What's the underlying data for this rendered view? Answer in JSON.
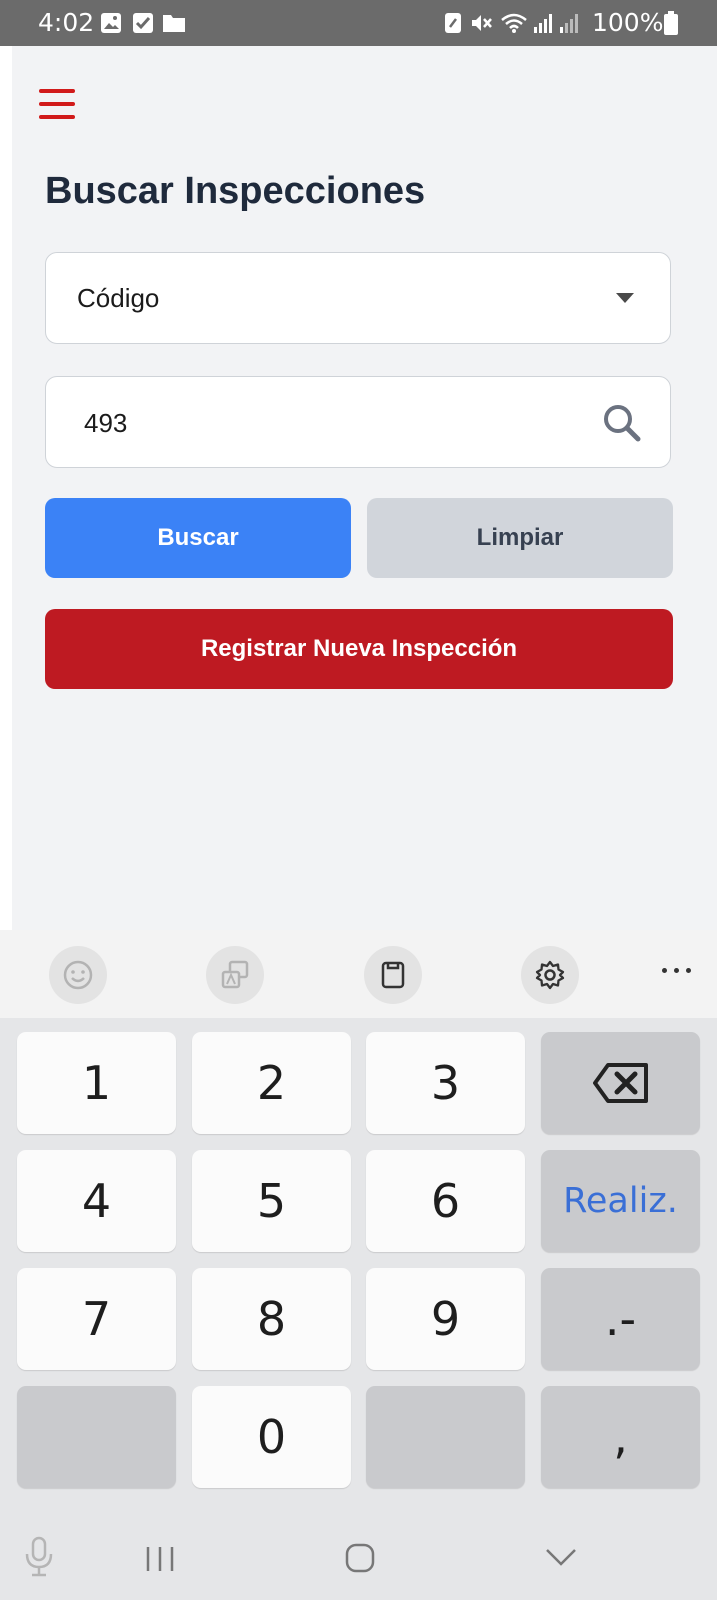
{
  "status_bar": {
    "time": "4:02",
    "battery": "100%",
    "left_icons": [
      "image-icon",
      "checkbox-icon",
      "folder-icon"
    ],
    "right_icons": [
      "nfc-icon",
      "mute-icon",
      "wifi-icon",
      "signal-icon",
      "signal-icon",
      "battery-icon"
    ]
  },
  "app": {
    "menu_icon": "hamburger-menu-icon",
    "title": "Buscar Inspecciones",
    "filter_select": {
      "value": "Código"
    },
    "search": {
      "value": "493",
      "icon": "search-icon"
    },
    "buttons": {
      "search": "Buscar",
      "clear": "Limpiar",
      "register": "Registrar Nueva Inspección"
    },
    "colors": {
      "accent_red": "#be1a22",
      "menu_red": "#d11a1a",
      "primary_blue": "#3b82f6",
      "secondary_gray": "#d1d5db",
      "title_color": "#1f2a3c"
    }
  },
  "keyboard": {
    "toolbar_icons": [
      "emoji-icon",
      "translate-icon",
      "clipboard-icon",
      "settings-icon",
      "more-icon"
    ],
    "rows": [
      [
        "1",
        "2",
        "3",
        "⌫"
      ],
      [
        "4",
        "5",
        "6",
        "Realiz."
      ],
      [
        "7",
        "8",
        "9",
        ".-"
      ],
      [
        "",
        "0",
        "",
        ","
      ]
    ],
    "done_color": "#3a6fd6"
  },
  "nav_bar": {
    "icons": [
      "microphone-icon",
      "recent-apps-icon",
      "home-icon",
      "hide-keyboard-icon"
    ]
  }
}
